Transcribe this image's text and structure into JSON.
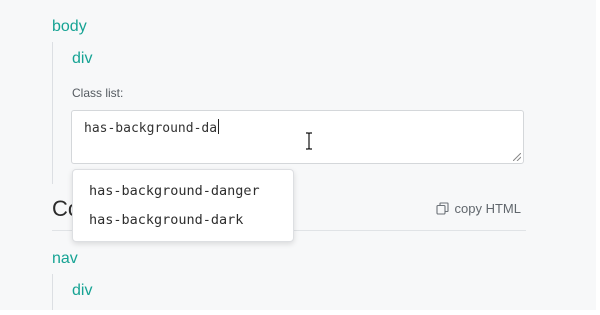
{
  "tree": {
    "body_tag": "body",
    "div_tag": "div",
    "class_list_label": "Class list:",
    "class_input_value": "has-background-da",
    "nav_tag": "nav",
    "nav_div_tag": "div"
  },
  "section": {
    "heading": "Co",
    "copy_html_label": "copy HTML",
    "copy_icon": "copy-icon"
  },
  "autocomplete": {
    "options": [
      "has-background-danger",
      "has-background-dark"
    ]
  },
  "colors": {
    "tag_accent": "#16a394",
    "background": "#f7f8f9"
  }
}
